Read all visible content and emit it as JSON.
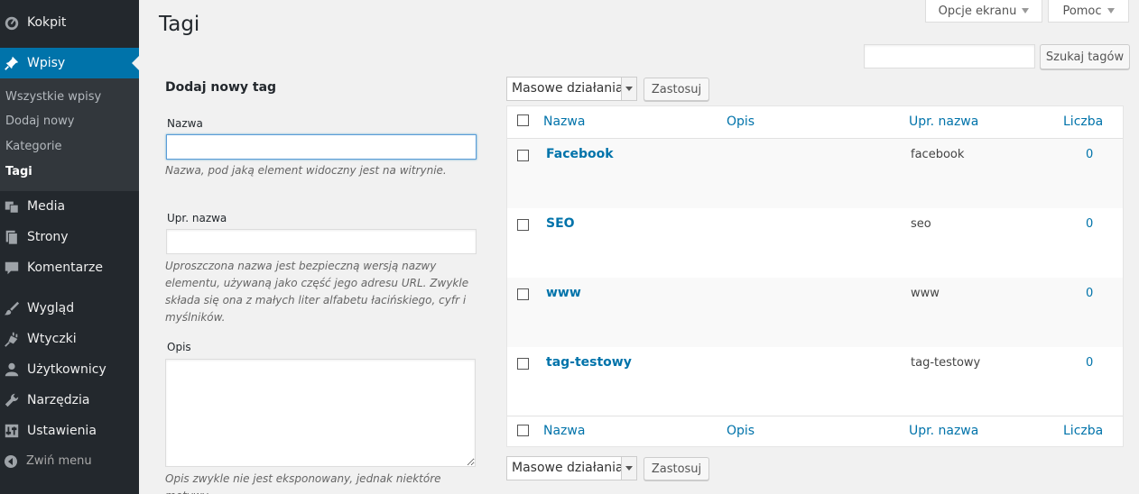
{
  "sidebar": {
    "items": [
      {
        "label": "Kokpit",
        "icon": "dashboard-icon"
      },
      {
        "label": "Wpisy",
        "icon": "pin-icon"
      },
      {
        "label": "Media",
        "icon": "media-icon"
      },
      {
        "label": "Strony",
        "icon": "pages-icon"
      },
      {
        "label": "Komentarze",
        "icon": "comment-icon"
      },
      {
        "label": "Wygląd",
        "icon": "brush-icon"
      },
      {
        "label": "Wtyczki",
        "icon": "plugin-icon"
      },
      {
        "label": "Użytkownicy",
        "icon": "user-icon"
      },
      {
        "label": "Narzędzia",
        "icon": "wrench-icon"
      },
      {
        "label": "Ustawienia",
        "icon": "settings-icon"
      }
    ],
    "submenu": [
      "Wszystkie wpisy",
      "Dodaj nowy",
      "Kategorie",
      "Tagi"
    ],
    "collapse_label": "Zwiń menu"
  },
  "header": {
    "title": "Tagi",
    "screen_options": "Opcje ekranu",
    "help": "Pomoc"
  },
  "search": {
    "value": "",
    "button": "Szukaj tagów"
  },
  "form": {
    "heading": "Dodaj nowy tag",
    "name_label": "Nazwa",
    "name_value": "",
    "name_help": "Nazwa, pod jaką element widoczny jest na witrynie.",
    "slug_label": "Upr. nazwa",
    "slug_value": "",
    "slug_help": "Uproszczona nazwa jest bezpieczną wersją nazwy elementu, używaną jako część jego adresu URL. Zwykle składa się ona z małych liter alfabetu łacińskiego, cyfr i myślników.",
    "desc_label": "Opis",
    "desc_value": "",
    "desc_help": "Opis zwykle nie jest eksponowany, jednak niektóre motywy"
  },
  "bulk": {
    "selected": "Masowe działania",
    "apply": "Zastosuj"
  },
  "table": {
    "columns": [
      "Nazwa",
      "Opis",
      "Upr. nazwa",
      "Liczba"
    ],
    "rows": [
      {
        "name": "Facebook",
        "description": "",
        "slug": "facebook",
        "count": "0"
      },
      {
        "name": "SEO",
        "description": "",
        "slug": "seo",
        "count": "0"
      },
      {
        "name": "www",
        "description": "",
        "slug": "www",
        "count": "0"
      },
      {
        "name": "tag-testowy",
        "description": "",
        "slug": "tag-testowy",
        "count": "0"
      }
    ]
  },
  "colors": {
    "sidebar_bg": "#23282d",
    "submenu_bg": "#32373c",
    "active": "#0073aa",
    "link": "#0073aa"
  }
}
